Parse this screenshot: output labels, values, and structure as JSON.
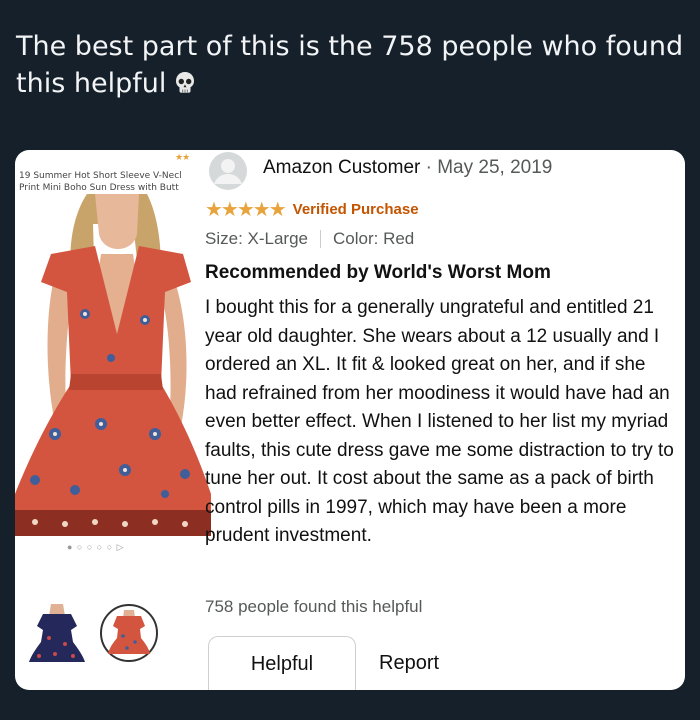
{
  "post": {
    "caption": "The best part of this is the 758 people who found this helpful",
    "emoji": "skull-emoji"
  },
  "product": {
    "title_line1": "19 Summer Hot Short Sleeve V-Necl",
    "title_line2": "Print Mini Boho Sun Dress with Butt",
    "stars": "★★",
    "carousel_dots": "● ○ ○ ○ ○ ▷",
    "dress_color": "#d4553f"
  },
  "review": {
    "reviewer": "Amazon Customer",
    "date_sep": "·",
    "date": "May 25, 2019",
    "stars": "★★★★★",
    "verified": "Verified Purchase",
    "size": "Size: X-Large",
    "color": "Color: Red",
    "headline": "Recommended by World's Worst Mom",
    "body": "I bought this for a generally ungrateful and entitled 21 year old daughter. She wears about a 12 usually and I ordered an XL. It fit & looked great on her, and if she had refrained from her moodiness it would have had an even better effect. When I listened to her list my myriad faults, this cute dress gave me some distraction to try to tune her out. It cost about the same as a pack of birth control pills in 1997, which may have been a more prudent investment.",
    "helpful_count": "758 people found this helpful",
    "helpful_button": "Helpful",
    "report_link": "Report"
  },
  "colors": {
    "background": "#15202b",
    "star": "#e8a33c",
    "verified": "#c45500"
  }
}
